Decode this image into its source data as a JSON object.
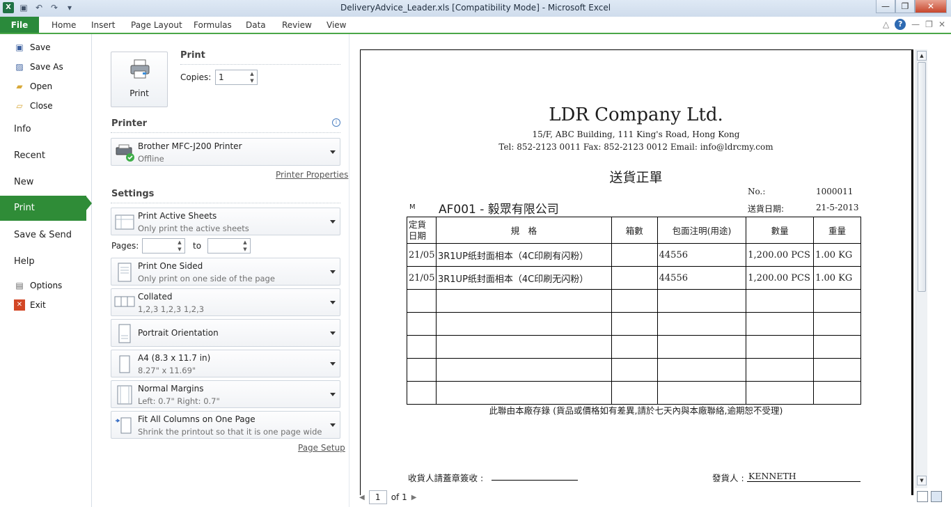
{
  "window": {
    "title": "DeliveryAdvice_Leader.xls  [Compatibility Mode]  -  Microsoft Excel",
    "close": "✕",
    "maximize": "❐",
    "minimize": "—"
  },
  "ribbon": {
    "file": "File",
    "tabs": [
      "Home",
      "Insert",
      "Page Layout",
      "Formulas",
      "Data",
      "Review",
      "View"
    ]
  },
  "nav": {
    "save": "Save",
    "save_as": "Save As",
    "open": "Open",
    "close": "Close",
    "info": "Info",
    "recent": "Recent",
    "new": "New",
    "print": "Print",
    "save_send": "Save & Send",
    "help": "Help",
    "options": "Options",
    "exit": "Exit"
  },
  "print": {
    "heading": "Print",
    "button": "Print",
    "copies_label": "Copies:",
    "copies": "1"
  },
  "printer": {
    "heading": "Printer",
    "name": "Brother MFC-J200 Printer",
    "status": "Offline",
    "properties": "Printer Properties"
  },
  "settings": {
    "heading": "Settings",
    "what": {
      "title": "Print Active Sheets",
      "sub": "Only print the active sheets"
    },
    "pages_label": "Pages:",
    "to_label": "to",
    "sides": {
      "title": "Print One Sided",
      "sub": "Only print on one side of the page"
    },
    "collate": {
      "title": "Collated",
      "sub": "1,2,3    1,2,3    1,2,3"
    },
    "orientation": {
      "title": "Portrait Orientation"
    },
    "paper": {
      "title": "A4 (8.3 x 11.7 in)",
      "sub": "8.27\" x 11.69\""
    },
    "margins": {
      "title": "Normal Margins",
      "sub": "Left:  0.7\"    Right:  0.7\""
    },
    "scaling": {
      "title": "Fit All Columns on One Page",
      "sub": "Shrink the printout so that it is one page wide"
    },
    "page_setup": "Page Setup"
  },
  "pager": {
    "current": "1",
    "of": "of 1"
  },
  "document": {
    "company": "LDR Company Ltd.",
    "address": "15/F, ABC Building, 111 King's Road, Hong Kong",
    "contact": "Tel: 852-2123 0011    Fax: 852-2123 0012    Email: info@ldrcmy.com",
    "title": "送貨正單",
    "no_label": "No.:",
    "no_value": "1000011",
    "date_label": "送貨日期:",
    "date_value": "21-5-2013",
    "customer_prefix": "M",
    "customer": "AF001 - 毅眾有限公司",
    "columns": [
      "定貨\n日期",
      "規　格",
      "箱數",
      "包面注明(用途)",
      "數量",
      "重量"
    ],
    "rows": [
      [
        "21/05",
        "3R1UP纸封面相本（4C印刷有闪粉）",
        "",
        "44556",
        "1,200.00 PCS",
        "1.00 KG"
      ],
      [
        "21/05",
        "3R1UP纸封面相本（4C印刷无闪粉）",
        "",
        "44556",
        "1,200.00 PCS",
        "1.00 KG"
      ]
    ],
    "footnote": "此聯由本廠存錄 (貨品或價格如有差異,請於七天內與本廠聯絡,逾期恕不受理)",
    "receiver_label": "收貨人請蓋章簽收 : ",
    "sender_label": "發貨人 :",
    "sender_value": "KENNETH"
  },
  "colors": {
    "accent": "#2f8c37",
    "file_tab": "#2a8a3b"
  }
}
